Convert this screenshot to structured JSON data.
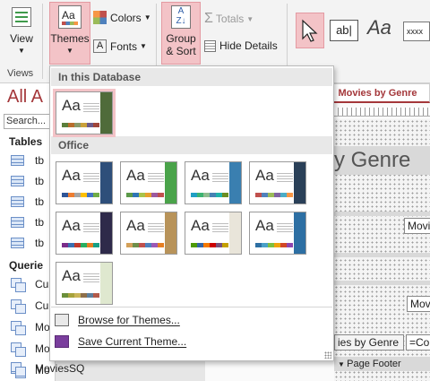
{
  "ribbon": {
    "views": {
      "button_label": "View",
      "group_label": "Views"
    },
    "themes_label": "Themes",
    "colors_label": "Colors",
    "fonts_label": "Fonts",
    "group_sort": {
      "line1": "Group",
      "line2": "& Sort"
    },
    "totals_label": "Totals",
    "hide_details_label": "Hide Details",
    "text_control_label": "ab|",
    "aa_label": "Aa",
    "xxxx_label": "xxxx"
  },
  "nav": {
    "title": "All A",
    "search_placeholder": "Search...",
    "tables_header": "Tables",
    "tables": [
      "tb",
      "tb",
      "tb",
      "tb",
      "tb"
    ],
    "queries_header": "Querie",
    "queries": [
      "Cu",
      "Cu",
      "Mo",
      "Mo",
      "Mo"
    ],
    "last_query": "MoviesSQ"
  },
  "design": {
    "tab_label": "Movies by Genre",
    "title_fragment": "y Genre",
    "field1": "Movi",
    "field2": "Movi",
    "footer_field": "ies by Genre",
    "footer_expr": "=Co",
    "page_footer": "Page Footer"
  },
  "dropdown": {
    "section_db": "In this Database",
    "section_office": "Office",
    "thumb_text": "Aa",
    "browse_label": "Browse for Themes...",
    "save_label": "Save Current Theme...",
    "themes": [
      {
        "name": "current",
        "accent": "#4f6b3a",
        "swatches": [
          "#5b7f3b",
          "#b86d2c",
          "#8a9a6a",
          "#c9a13a",
          "#6b5a8a",
          "#a0463a"
        ]
      },
      {
        "name": "office-1",
        "accent": "#2e4f7a",
        "swatches": [
          "#2f5597",
          "#ed7d31",
          "#a5a5a5",
          "#ffc000",
          "#4472c4",
          "#70ad47"
        ]
      },
      {
        "name": "office-2",
        "accent": "#4aa34a",
        "swatches": [
          "#5c9a4a",
          "#2e75b6",
          "#a9c34a",
          "#e7a02d",
          "#9c5aa0",
          "#c0504d"
        ]
      },
      {
        "name": "office-3",
        "accent": "#3a7fb0",
        "swatches": [
          "#1f9fc4",
          "#3cb371",
          "#8fbc8f",
          "#4682b4",
          "#20b2aa",
          "#6b8e23"
        ]
      },
      {
        "name": "office-4",
        "accent": "#2a4058",
        "swatches": [
          "#c0504d",
          "#4f81bd",
          "#9bbb59",
          "#8064a2",
          "#4bacc6",
          "#f79646"
        ]
      },
      {
        "name": "office-5",
        "accent": "#2e2a4a",
        "swatches": [
          "#7b2c8a",
          "#3a6fb0",
          "#c0392b",
          "#27ae60",
          "#e67e22",
          "#16a085"
        ]
      },
      {
        "name": "office-6",
        "accent": "#b8935a",
        "swatches": [
          "#d4a15a",
          "#6f8f4a",
          "#c0504d",
          "#4f81bd",
          "#9b59b6",
          "#e67e22"
        ]
      },
      {
        "name": "office-7",
        "accent": "#e9e5da",
        "swatches": [
          "#4e9a06",
          "#3465a4",
          "#f57900",
          "#cc0000",
          "#75507b",
          "#c4a000"
        ]
      },
      {
        "name": "office-8",
        "accent": "#2d6fa3",
        "swatches": [
          "#2d6fa3",
          "#4aa0c8",
          "#7fbf3f",
          "#f0a30a",
          "#d24726",
          "#8e44ad"
        ]
      },
      {
        "name": "office-9",
        "accent": "#dfe8cf",
        "swatches": [
          "#6a8f3a",
          "#a6a23c",
          "#c9b458",
          "#8e6f4a",
          "#5d7f9c",
          "#b35a4a"
        ]
      }
    ]
  }
}
